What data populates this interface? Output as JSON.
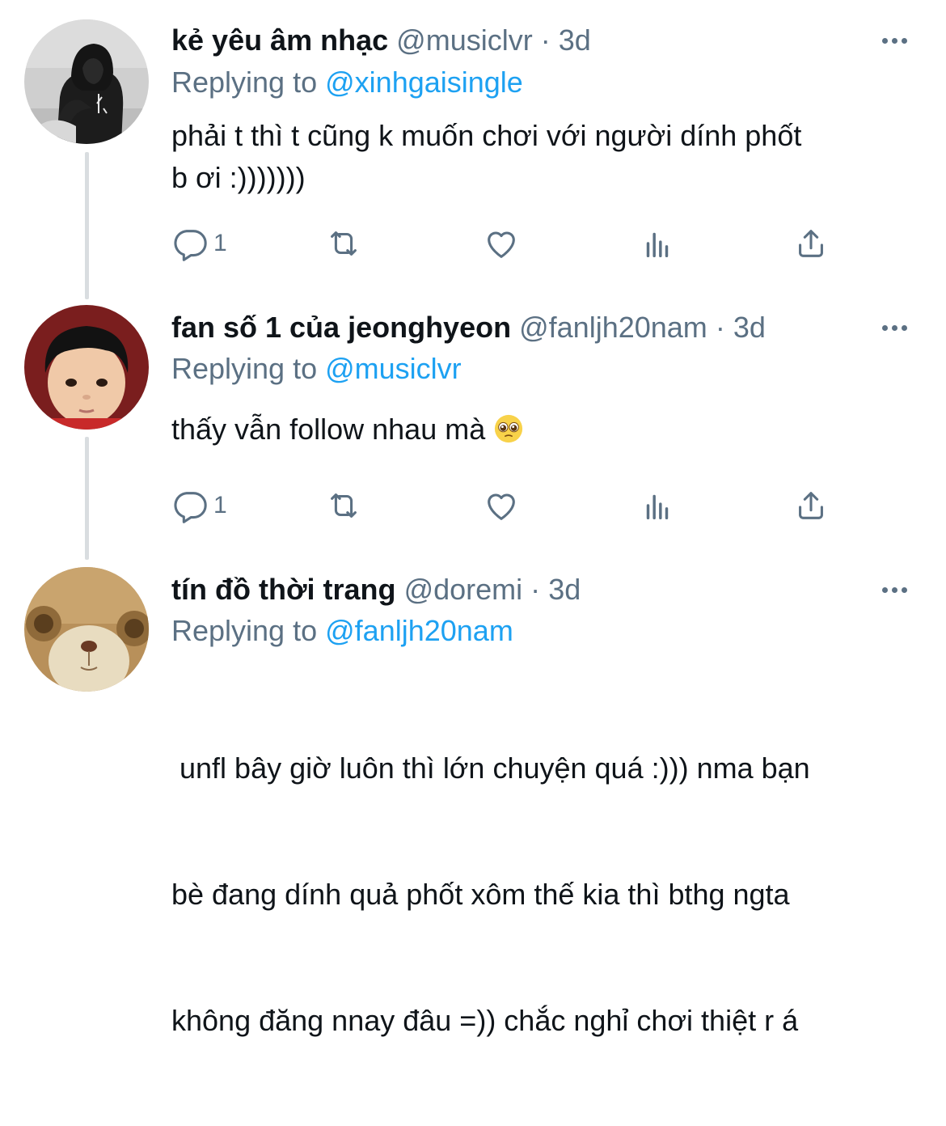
{
  "tweets": [
    {
      "name": "kẻ yêu âm nhạc",
      "handle": "@musiclvr",
      "separator": "·",
      "time": "3d",
      "replying_prefix": "Replying to",
      "replying_to": "@xinhgaisingle",
      "text_lines": [
        "phải t thì t cũng k muốn chơi với người dính phốt",
        "b ơi :)))))))"
      ],
      "reply_count": "1",
      "avatar": "hooded-person-avatar"
    },
    {
      "name": "fan số 1 của jeonghyeon",
      "handle": "@fanljh20nam",
      "separator": "·",
      "time": "3d",
      "replying_prefix": "Replying to",
      "replying_to": "@musiclvr",
      "text": "thấy vẫn follow nhau mà",
      "emoji": "pleading-face-emoji",
      "reply_count": "1",
      "avatar": "child-avatar"
    },
    {
      "name": "tín đồ thời trang",
      "handle": "@doremi",
      "separator": "·",
      "time": "3d",
      "replying_prefix": "Replying to",
      "replying_to": "@fanljh20nam",
      "text_lines": [
        " unfl bây giờ luôn thì lớn chuyện quá :))) nma bạn",
        "bè đang dính quả phốt xôm thế kia thì bthg ngta",
        "không đăng nnay đâu =)) chắc nghỉ chơi thiệt r á"
      ],
      "avatar": "teddy-bear-avatar"
    }
  ],
  "icons": {
    "reply": "reply-icon",
    "retweet": "retweet-icon",
    "like": "heart-icon",
    "analytics": "analytics-icon",
    "share": "share-icon",
    "more": "more-icon"
  },
  "colors": {
    "name": "#0f1419",
    "secondary": "#5b7083",
    "link": "#1da1f2",
    "thread_line": "#d9dde0"
  }
}
